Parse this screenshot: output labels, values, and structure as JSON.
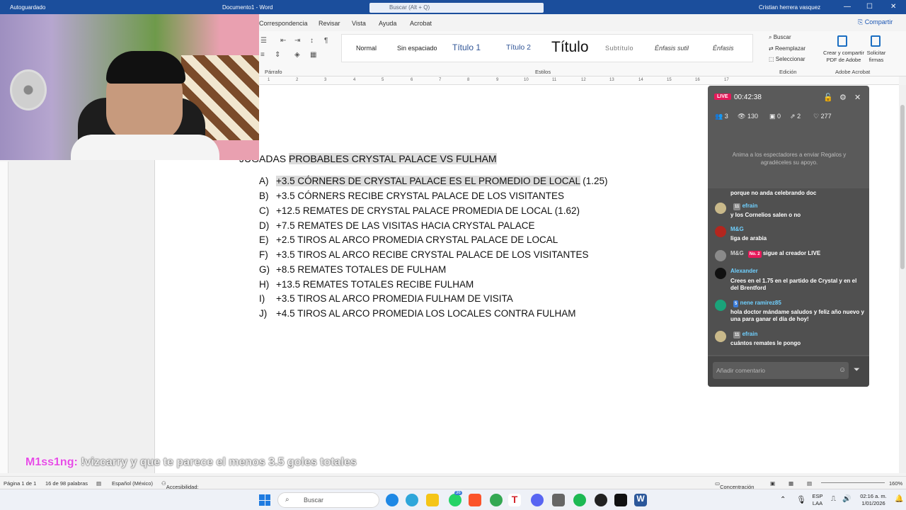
{
  "titlebar": {
    "autosave_label": "Autoguardado",
    "doc_title": "Documento1 - Word",
    "search_placeholder": "Buscar (Alt + Q)",
    "username": "Cristian herrera vasquez",
    "minimize": "—",
    "maximize": "☐",
    "close": "✕"
  },
  "ribbon_tabs": {
    "items": [
      "Correspondencia",
      "Revisar",
      "Vista",
      "Ayuda",
      "Acrobat"
    ],
    "share_label": "Compartir"
  },
  "ribbon": {
    "paragraph_label": "Párrafo",
    "styles_label": "Estilos",
    "editing_label": "Edición",
    "adobe_label": "Adobe Acrobat",
    "styles": [
      "Normal",
      "Sin espaciado",
      "Título 1",
      "Título 2",
      "Título",
      "Subtítulo",
      "Énfasis sutil",
      "Énfasis"
    ],
    "edit_buscar": "Buscar",
    "edit_reemplazar": "Reemplazar",
    "edit_seleccionar": "Seleccionar",
    "adobe_create_1": "Crear y compartir",
    "adobe_create_2": "PDF de Adobe",
    "adobe_sign_1": "Solicitar",
    "adobe_sign_2": "firmas"
  },
  "ruler": {
    "ticks": [
      "1",
      "2",
      "3",
      "4",
      "5",
      "6",
      "7",
      "8",
      "9",
      "10",
      "11",
      "12",
      "13",
      "14",
      "15",
      "16",
      "17"
    ]
  },
  "document": {
    "heading_prefix": "JUGADAS",
    "heading_rest": "PROBABLES CRYSTAL PALACE VS FULHAM",
    "items": [
      {
        "letter": "A)",
        "text": "+3.5 CÓRNERS DE CRYSTAL PALACE ES EL PROMEDIO DE LOCAL",
        "suffix": " (1.25)"
      },
      {
        "letter": "B)",
        "text": "+3.5 CÓRNERS RECIBE CRYSTAL PALACE DE LOS VISITANTES",
        "suffix": ""
      },
      {
        "letter": "C)",
        "text": "+12.5 REMATES DE CRYSTAL PALACE PROMEDIA DE LOCAL (1.62)",
        "suffix": ""
      },
      {
        "letter": "D)",
        "text": "+7.5 REMATES DE LAS VISITAS HACIA CRYSTAL PALACE",
        "suffix": ""
      },
      {
        "letter": "E)",
        "text": "+2.5 TIROS AL ARCO PROMEDIA CRYSTAL PALACE DE LOCAL",
        "suffix": ""
      },
      {
        "letter": "F)",
        "text": "+3.5 TIROS AL ARCO RECIBE CRYSTAL PALACE DE LOS VISITANTES",
        "suffix": ""
      },
      {
        "letter": "G)",
        "text": "+8.5 REMATES TOTALES DE FULHAM",
        "suffix": ""
      },
      {
        "letter": "H)",
        "text": "+13.5 REMATES TOTALES RECIBE FULHAM",
        "suffix": ""
      },
      {
        "letter": "I)",
        "text": "+3.5 TIROS AL ARCO PROMEDIA FULHAM DE VISITA",
        "suffix": ""
      },
      {
        "letter": "J)",
        "text": "+4.5 TIROS AL ARCO PROMEDIA LOS LOCALES CONTRA FULHAM",
        "suffix": ""
      }
    ]
  },
  "live_panel": {
    "badge": "LIVE",
    "timer": "00:42:38",
    "stats": {
      "guests": "3",
      "viewers": "130",
      "gifts": "0",
      "shares": "2",
      "likes": "277"
    },
    "hint": "Anima a los espectadores a enviar Regalos y agradéceles su apoyo.",
    "messages": [
      {
        "user": "",
        "level": "",
        "text": "porque no anda celebrando doc",
        "avatar_color": "#505050"
      },
      {
        "user": "efrain",
        "level": "11",
        "text": "y los Cornelios salen o no",
        "avatar_color": "#c9b98a"
      },
      {
        "user": "M&G",
        "level": "",
        "text": "liga de arabia",
        "avatar_color": "#b3261e"
      },
      {
        "user": "M&G",
        "level": "No. 2",
        "text": "sigue al creador LIVE",
        "avatar_color": "#8a8a8a"
      },
      {
        "user": "Alexander",
        "level": "",
        "text": "Crees en el 1.75 en el partido de Crystal y en el del Brentford",
        "avatar_color": "#111111"
      },
      {
        "user": "nene ramirez85",
        "level": "5",
        "text": "hola doctor mándame saludos y feliz año nuevo y una para ganar el día de hoy!",
        "avatar_color": "#1aa37a"
      },
      {
        "user": "efrain",
        "level": "11",
        "text": "cuántos remates le pongo",
        "avatar_color": "#c9b98a"
      }
    ],
    "input_placeholder": "Añadir comentario"
  },
  "subtitle": {
    "name": "M1ss1ng:",
    "text": " !vizcarry y que te parece el menos 3.5 goles totales"
  },
  "statusbar": {
    "page": "Página 1 de 1",
    "words": "16 de 98 palabras",
    "language": "Español (México)",
    "accessibility": "Accesibilidad: todo correcto",
    "focus": "Concentración",
    "zoom": "160%"
  },
  "taskbar": {
    "search_label": "Buscar",
    "badge_count": "36",
    "lang_1": "ESP",
    "lang_2": "LAA",
    "time": "02:16 a. m.",
    "date": "1/01/2026"
  },
  "colors": {
    "titlebar": "#1b4e9c",
    "live_badge": "#e6195a",
    "chat_username": "#6fd0ff",
    "subtitle_name": "#e64ce6"
  }
}
